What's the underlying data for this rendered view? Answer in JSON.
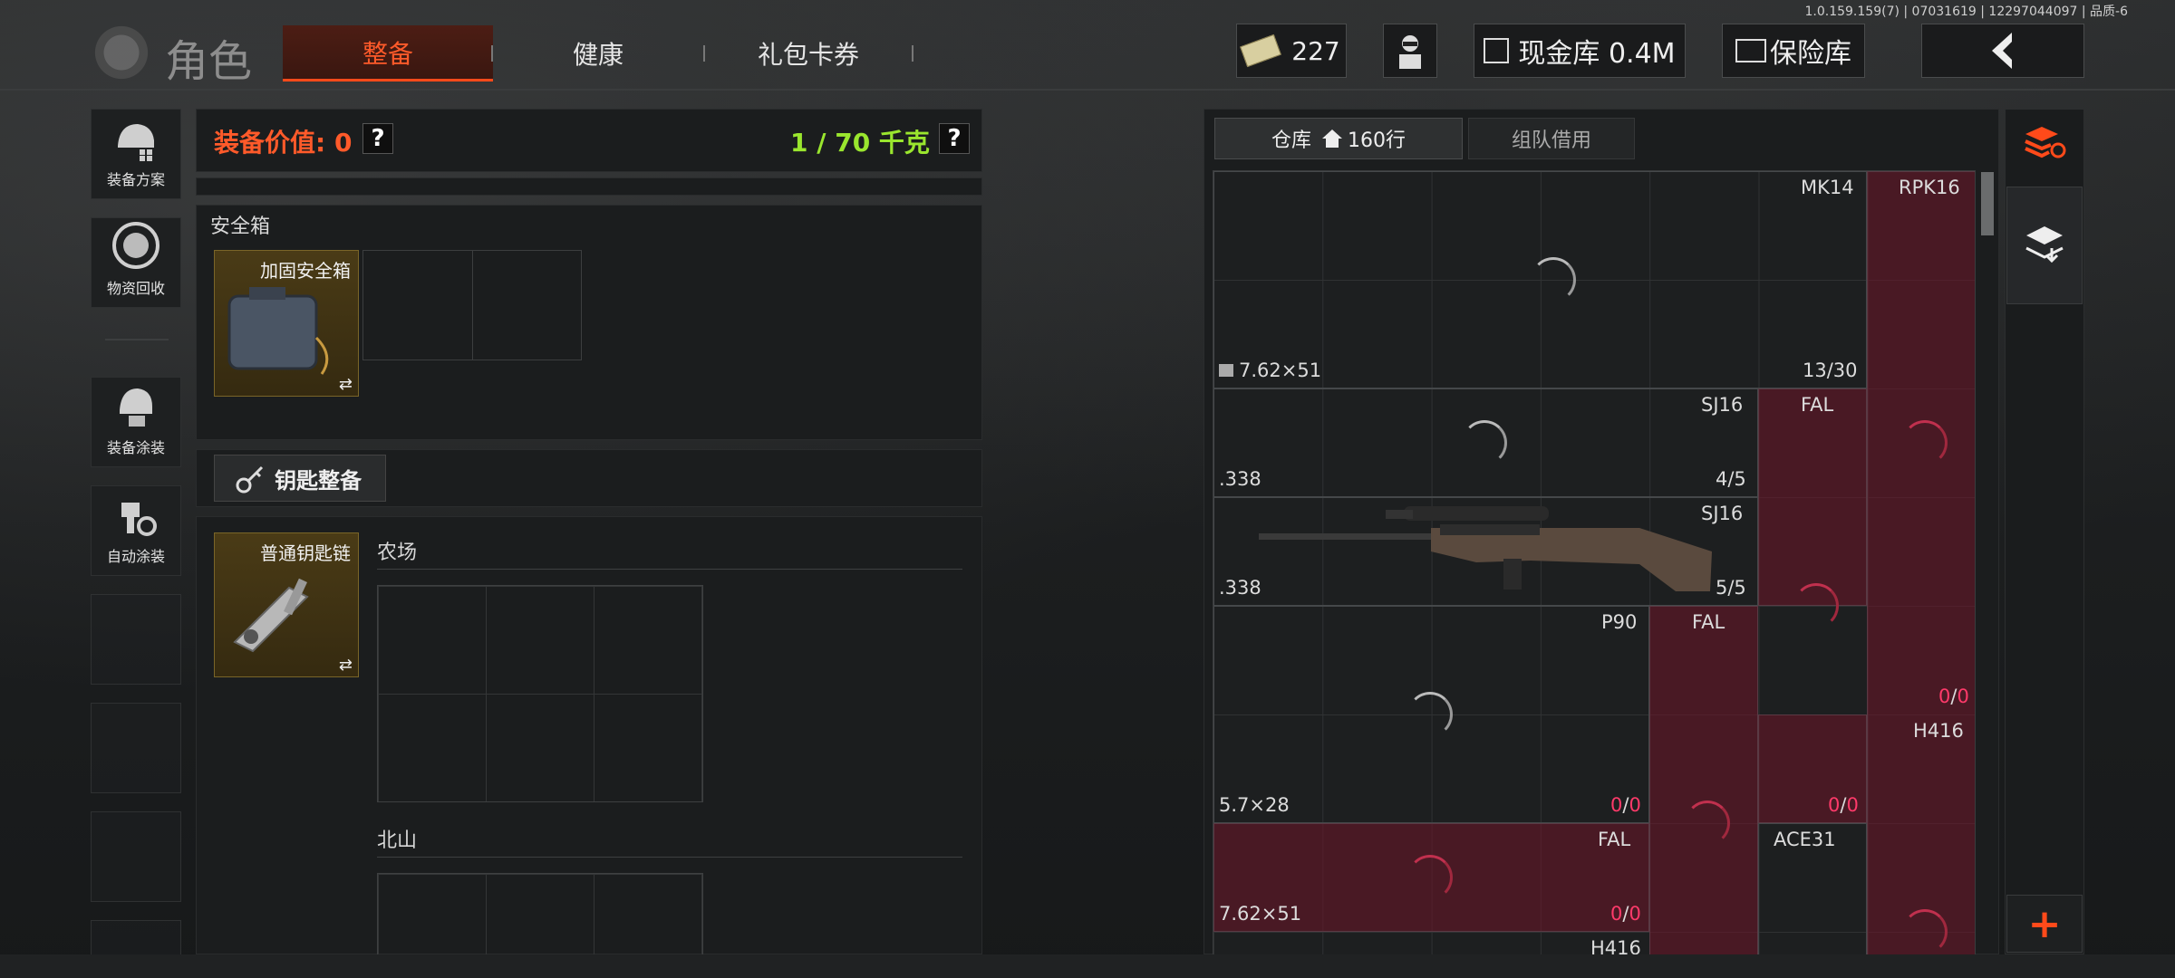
{
  "version": "1.0.159.159(7) | 07031619 | 12297044097 | 品质-6",
  "header": {
    "brand": "角色",
    "tabs": [
      {
        "label": "整备",
        "active": true
      },
      {
        "label": "健康",
        "active": false
      },
      {
        "label": "礼包卡券",
        "active": false
      }
    ],
    "currency": "227",
    "cash_vault": "现金库 0.4M",
    "safe_vault": "保险库"
  },
  "sidebar": {
    "items": [
      {
        "label": "装备方案",
        "icon": "helmet-icon"
      },
      {
        "label": "物资回收",
        "icon": "recycle-icon"
      },
      {
        "label": "装备涂装",
        "icon": "paint-helmet-icon"
      },
      {
        "label": "自动涂装",
        "icon": "auto-paint-icon"
      }
    ]
  },
  "loadout": {
    "value_label": "装备价值: 0",
    "weight_label": "1 / 70 千克",
    "help": "?",
    "safe_box": {
      "title": "安全箱",
      "item": "加固安全箱",
      "swap": "⇄"
    },
    "keys_button": "钥匙整备",
    "keychain": {
      "item": "普通钥匙链",
      "swap": "⇄"
    },
    "maps": [
      {
        "label": "农场"
      },
      {
        "label": "北山"
      }
    ]
  },
  "warehouse": {
    "tabs": [
      {
        "label": "仓库",
        "suffix": "160行",
        "active": true
      },
      {
        "label": "组队借用",
        "active": false
      }
    ],
    "items": [
      {
        "name": "MK14",
        "caliber": "7.62×51",
        "count": "13/30"
      },
      {
        "name": "RPK16"
      },
      {
        "name": "SJ16",
        "caliber": ".338",
        "count": "4/5"
      },
      {
        "name": "FAL"
      },
      {
        "name": "SJ16",
        "caliber": ".338",
        "count": "5/5"
      },
      {
        "name": "P90",
        "caliber": "5.7×28",
        "count_a": "0",
        "count_b": "0"
      },
      {
        "name": "FAL"
      },
      {
        "name": "H416",
        "count_a": "0",
        "count_b": "0"
      },
      {
        "name": "FAL",
        "caliber": "7.62×51",
        "count_a": "0",
        "count_b": "0"
      },
      {
        "name": "ACE31"
      },
      {
        "name": "H416"
      }
    ],
    "misc_counts": [
      {
        "a": "0",
        "b": "0"
      },
      {
        "a": "0",
        "b": "0"
      }
    ],
    "add": "+"
  }
}
